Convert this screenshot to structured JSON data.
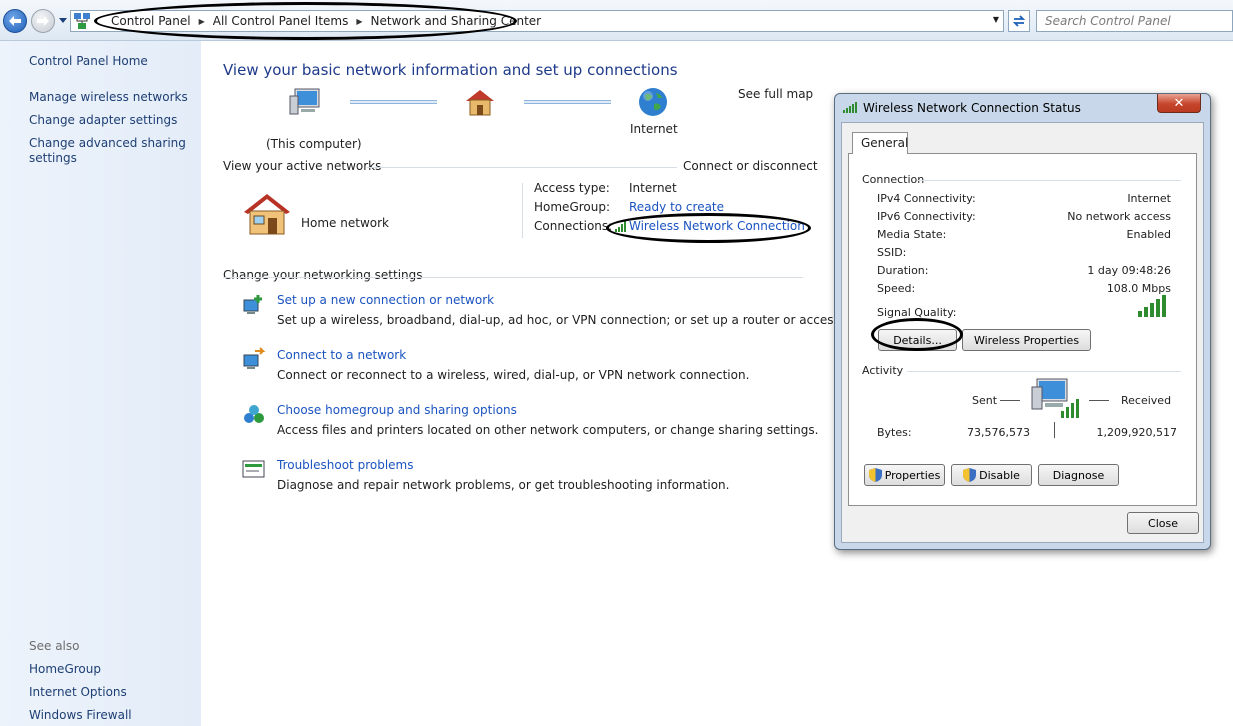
{
  "address_bar": {
    "breadcrumbs": [
      "Control Panel",
      "All Control Panel Items",
      "Network and Sharing Center"
    ],
    "search_placeholder": "Search Control Panel"
  },
  "left_pane": {
    "home": "Control Panel Home",
    "links": [
      "Manage wireless networks",
      "Change adapter settings",
      "Change advanced sharing settings"
    ],
    "see_also_label": "See also",
    "see_also": [
      "HomeGroup",
      "Internet Options",
      "Windows Firewall"
    ]
  },
  "main": {
    "title": "View your basic network information and set up connections",
    "see_full_map": "See full map",
    "map": {
      "computer_label": "(This computer)",
      "internet_label": "Internet"
    },
    "active_networks": {
      "heading": "View your active networks",
      "connect_link": "Connect or disconnect",
      "network_name": "Home network",
      "access_type_label": "Access type:",
      "access_type_value": "Internet",
      "homegroup_label": "HomeGroup:",
      "homegroup_value": "Ready to create",
      "connections_label": "Connections:",
      "connections_value": "Wireless Network Connection"
    },
    "change_settings": {
      "heading": "Change your networking settings",
      "tasks": [
        {
          "title": "Set up a new connection or network",
          "desc": "Set up a wireless, broadband, dial-up, ad hoc, or VPN connection; or set up a router or access point."
        },
        {
          "title": "Connect to a network",
          "desc": "Connect or reconnect to a wireless, wired, dial-up, or VPN network connection."
        },
        {
          "title": "Choose homegroup and sharing options",
          "desc": "Access files and printers located on other network computers, or change sharing settings."
        },
        {
          "title": "Troubleshoot problems",
          "desc": "Diagnose and repair network problems, or get troubleshooting information."
        }
      ]
    }
  },
  "dialog": {
    "title": "Wireless Network Connection Status",
    "close_glyph": "✕",
    "tab": "General",
    "connection": {
      "heading": "Connection",
      "rows": [
        {
          "label": "IPv4 Connectivity:",
          "value": "Internet"
        },
        {
          "label": "IPv6 Connectivity:",
          "value": "No network access"
        },
        {
          "label": "Media State:",
          "value": "Enabled"
        },
        {
          "label": "SSID:",
          "value": ""
        },
        {
          "label": "Duration:",
          "value": "1 day 09:48:26"
        },
        {
          "label": "Speed:",
          "value": "108.0 Mbps"
        }
      ],
      "signal_label": "Signal Quality:",
      "signal_bars": 5,
      "details_button": "Details...",
      "wireless_properties_button": "Wireless Properties"
    },
    "activity": {
      "heading": "Activity",
      "sent_label": "Sent",
      "received_label": "Received",
      "bytes_label": "Bytes:",
      "sent_bytes": "73,576,573",
      "received_bytes": "1,209,920,517"
    },
    "buttons": {
      "properties": "Properties",
      "disable": "Disable",
      "diagnose": "Diagnose",
      "close": "Close"
    }
  },
  "colors": {
    "link": "#1a53c0",
    "title": "#1e3a8a",
    "nav_pane": "#e8f0fa",
    "signal": "#2e8b2e"
  }
}
